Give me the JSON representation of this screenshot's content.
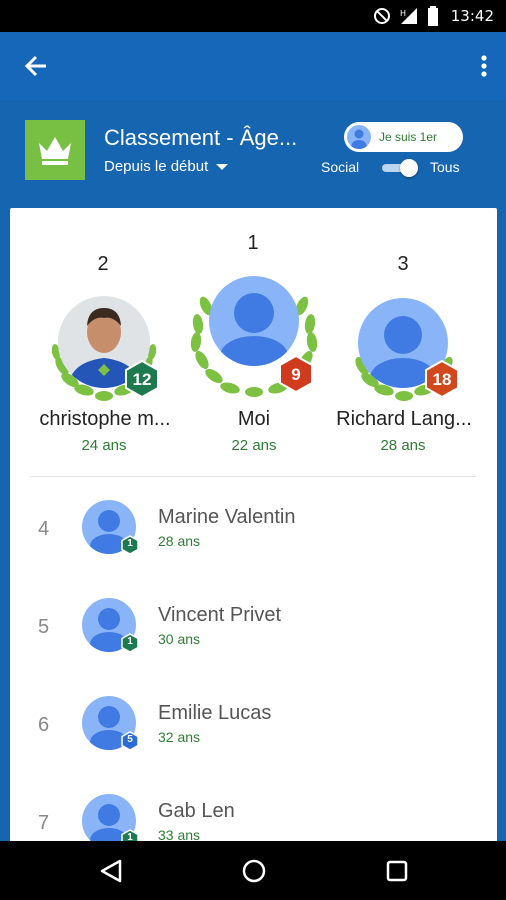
{
  "status_bar": {
    "time": "13:42",
    "icons": [
      "do-not-disturb-icon",
      "signal-icon",
      "battery-icon"
    ]
  },
  "app_bar": {
    "back_icon": "arrow-back-icon",
    "menu_icon": "more-vert-icon"
  },
  "header": {
    "title": "Classement - Âge...",
    "filter_label": "Depuis le début",
    "crown_icon": "crown-icon",
    "crown_bg": "#78c043",
    "me_first_label": "Je suis 1er",
    "social_label": "Social",
    "all_label": "Tous",
    "toggle_state": "Tous"
  },
  "podium": [
    {
      "rank": "2",
      "name": "christophe m...",
      "age": "24 ans",
      "level": "12",
      "badge_color": "#1d7a4f",
      "photo": true
    },
    {
      "rank": "1",
      "name": "Moi",
      "age": "22 ans",
      "level": "9",
      "badge_color": "#d23a1e",
      "photo": false
    },
    {
      "rank": "3",
      "name": "Richard Lang...",
      "age": "28 ans",
      "level": "18",
      "badge_color": "#d0481b",
      "photo": false
    }
  ],
  "list": [
    {
      "rank": "4",
      "name": "Marine Valentin",
      "age": "28 ans",
      "level": "1",
      "badge_color": "#1d7a4f"
    },
    {
      "rank": "5",
      "name": "Vincent Privet",
      "age": "30 ans",
      "level": "1",
      "badge_color": "#1d7a4f"
    },
    {
      "rank": "6",
      "name": "Emilie Lucas",
      "age": "32 ans",
      "level": "5",
      "badge_color": "#2b6dd6"
    },
    {
      "rank": "7",
      "name": "Gab Len",
      "age": "33 ans",
      "level": "1",
      "badge_color": "#1d7a4f"
    }
  ],
  "colors": {
    "primary": "#1565b0",
    "accent_green": "#2e7d32",
    "laurel": "#7cc142",
    "avatar_bg": "#8ab4f8",
    "avatar_fg": "#3f7be3"
  },
  "nav_bar": {
    "icons": [
      "nav-back-icon",
      "nav-home-icon",
      "nav-recents-icon"
    ]
  }
}
